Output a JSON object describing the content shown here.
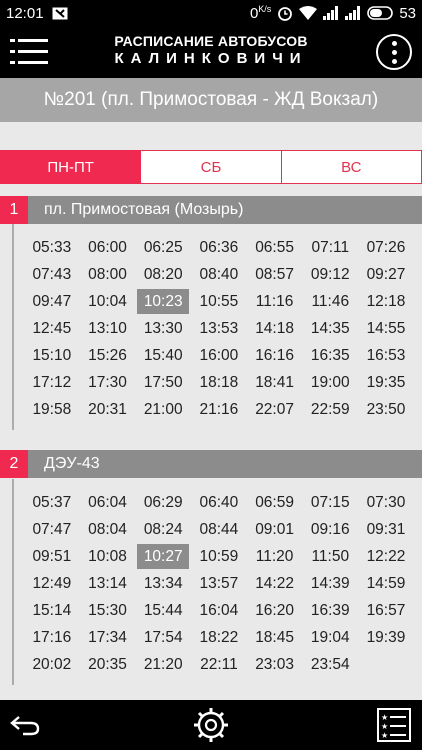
{
  "status_bar": {
    "time": "12:01",
    "speed": "0",
    "speed_unit": "K/s",
    "battery": "53"
  },
  "app": {
    "title_line1": "РАСПИСАНИЕ АВТОБУСОВ",
    "title_line2": "КАЛИНКОВИЧИ"
  },
  "route": {
    "title": "№201 (пл. Примостовая - ЖД Вокзал)"
  },
  "tabs": [
    "ПН-ПТ",
    "СБ",
    "ВС"
  ],
  "active_tab": "ПН-ПТ",
  "stops": [
    {
      "number": "1",
      "name": "пл. Примостовая (Мозырь)",
      "current_time": "10:23",
      "times": [
        "05:33",
        "06:00",
        "06:25",
        "06:36",
        "06:55",
        "07:11",
        "07:26",
        "07:43",
        "08:00",
        "08:20",
        "08:40",
        "08:57",
        "09:12",
        "09:27",
        "09:47",
        "10:04",
        "10:23",
        "10:55",
        "11:16",
        "11:46",
        "12:18",
        "12:45",
        "13:10",
        "13:30",
        "13:53",
        "14:18",
        "14:35",
        "14:55",
        "15:10",
        "15:26",
        "15:40",
        "16:00",
        "16:16",
        "16:35",
        "16:53",
        "17:12",
        "17:30",
        "17:50",
        "18:18",
        "18:41",
        "19:00",
        "19:35",
        "19:58",
        "20:31",
        "21:00",
        "21:16",
        "22:07",
        "22:59",
        "23:50"
      ]
    },
    {
      "number": "2",
      "name": "ДЭУ-43",
      "current_time": "10:27",
      "times": [
        "05:37",
        "06:04",
        "06:29",
        "06:40",
        "06:59",
        "07:15",
        "07:30",
        "07:47",
        "08:04",
        "08:24",
        "08:44",
        "09:01",
        "09:16",
        "09:31",
        "09:51",
        "10:08",
        "10:27",
        "10:59",
        "11:20",
        "11:50",
        "12:22",
        "12:49",
        "13:14",
        "13:34",
        "13:57",
        "14:22",
        "14:39",
        "14:59",
        "15:14",
        "15:30",
        "15:44",
        "16:04",
        "16:20",
        "16:39",
        "16:57",
        "17:16",
        "17:34",
        "17:54",
        "18:22",
        "18:45",
        "19:04",
        "19:39",
        "20:02",
        "20:35",
        "21:20",
        "22:11",
        "23:03",
        "23:54"
      ]
    }
  ],
  "icons": {
    "menu": "hamburger-icon",
    "more": "more-vertical-icon",
    "back": "back-arrow-icon",
    "settings": "gear-icon",
    "list": "star-list-icon"
  },
  "colors": {
    "accent": "#ef2950",
    "header_gray": "#a6a6a6",
    "stop_gray": "#8c8c8c"
  }
}
